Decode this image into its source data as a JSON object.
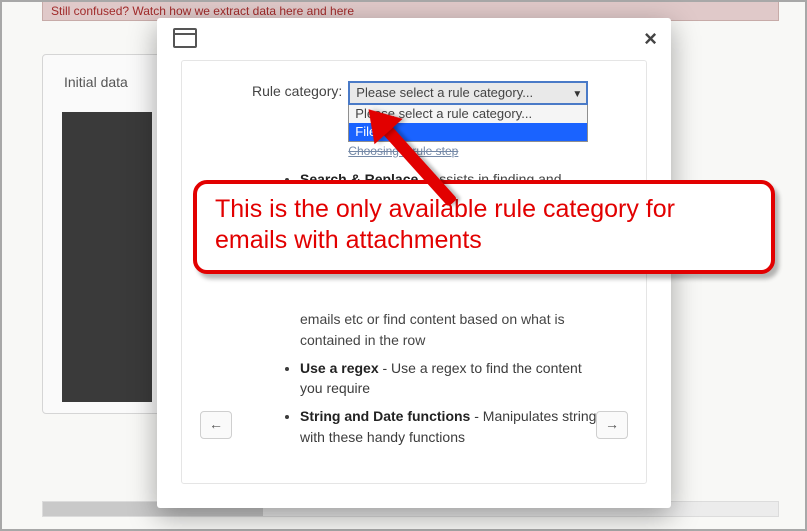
{
  "background": {
    "banner_text": "Still confused? Watch how we extract data here and here",
    "panel_label": "Initial data"
  },
  "modal": {
    "category_label": "Rule category:",
    "select_placeholder": "Please select a rule category...",
    "options": {
      "placeholder": "Please select a rule category...",
      "files": "Files"
    },
    "under_link": "Choosing a rule step",
    "bullets": {
      "b1_title": "Search & Replace",
      "b1_frag": " - Assists in finding and",
      "mid_frag": "emails etc or find content based on what is contained in the row",
      "b3_title": "Use a regex",
      "b3_text": " - Use a regex to find the content you require",
      "b4_title": "String and Date functions",
      "b4_text": " - Manipulates strings with these handy functions"
    },
    "nav": {
      "prev": "←",
      "next": "→"
    }
  },
  "callout": {
    "text": "This is the only available rule category for emails with attachments"
  }
}
